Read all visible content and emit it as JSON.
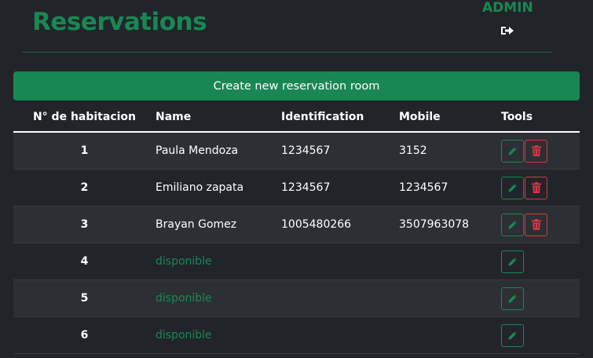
{
  "header": {
    "title": "Reservations",
    "user_label": "ADMIN",
    "logout_icon": "sign-out-icon"
  },
  "create_button_label": "Create new reservation room",
  "table": {
    "columns": [
      "N° de habitacion",
      "Name",
      "Identification",
      "Mobile",
      "Tools"
    ],
    "rows": [
      {
        "room": "1",
        "name": "Paula Mendoza",
        "identification": "1234567",
        "mobile": "3152",
        "deletable": true
      },
      {
        "room": "2",
        "name": "Emiliano zapata",
        "identification": "1234567",
        "mobile": "1234567",
        "deletable": true
      },
      {
        "room": "3",
        "name": "Brayan Gomez",
        "identification": "1005480266",
        "mobile": "3507963078",
        "deletable": true
      },
      {
        "room": "4",
        "name": "disponible",
        "identification": "",
        "mobile": "",
        "deletable": false
      },
      {
        "room": "5",
        "name": "disponible",
        "identification": "",
        "mobile": "",
        "deletable": false
      },
      {
        "room": "6",
        "name": "disponible",
        "identification": "",
        "mobile": "",
        "deletable": false
      }
    ]
  },
  "colors": {
    "background": "#212529",
    "accent": "#198754",
    "danger": "#dc3545"
  }
}
